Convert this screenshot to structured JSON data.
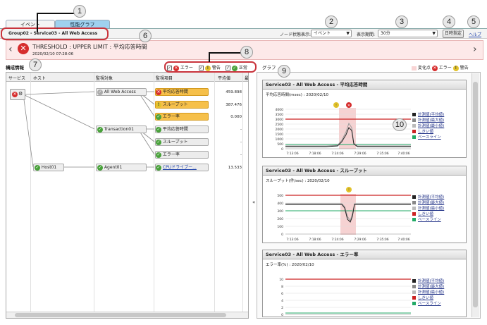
{
  "tabs": {
    "event": "イベント",
    "graph": "性能グラフ"
  },
  "breadcrumb": "Group02 - Service03 - All Web Access",
  "toolbar": {
    "node_status_label": "ノード状態表示:",
    "node_status_value": "イベント",
    "period_label": "表示期間:",
    "period_value": "30分",
    "time_button": "日時指定",
    "help_button": "ヘルプ"
  },
  "alert": {
    "title": "THRESHOLD : UPPER LIMIT : 平均応答時間",
    "time": "2020/02/10 07:28:06"
  },
  "config": {
    "title": "構成情報",
    "filters": {
      "error": "エラー",
      "warning": "警告",
      "normal": "正常"
    },
    "columns": [
      "サービス",
      "ホスト",
      "監視対象",
      "監視項目",
      "平均値",
      "最"
    ],
    "targets": [
      "All Web Access",
      "Transaction01",
      "Agent01"
    ],
    "host": "Host01",
    "items": [
      {
        "label": "平均応答時間",
        "value": "459.898"
      },
      {
        "label": "スループット",
        "value": "387.476"
      },
      {
        "label": "エラー率",
        "value": "0.000"
      },
      {
        "label": "平均応答時間",
        "value": "-"
      },
      {
        "label": "スループット",
        "value": "-"
      },
      {
        "label": "エラー率",
        "value": "-"
      },
      {
        "label": "CPUドライブー...",
        "value": "13.533"
      }
    ]
  },
  "graph": {
    "title": "グラフ",
    "legend_change": "変化点",
    "legend_error": "エラー",
    "legend_warning": "警告",
    "collapse": "«",
    "panels": [
      {
        "header": "Service03 - All Web Access - 平均応答時間",
        "sub": "平均応答時間(msec) : 2020/02/10",
        "yticks": [
          "4000",
          "3500",
          "3000",
          "2500",
          "2000",
          "1500",
          "1000",
          "500",
          "0"
        ],
        "xticks": [
          "7:13:06",
          "7:18:06",
          "7:24:06",
          "7:29:06",
          "7:35:06",
          "7:40:06"
        ]
      },
      {
        "header": "Service03 - All Web Access - スループット",
        "sub": "スループット(件/sec) : 2020/02/10",
        "yticks": [
          "500",
          "400",
          "300",
          "200",
          "100",
          "0"
        ],
        "xticks": [
          "7:13:06",
          "7:18:06",
          "7:24:06",
          "7:29:06",
          "7:35:06",
          "7:40:06"
        ]
      },
      {
        "header": "Service03 - All Web Access - エラー率",
        "sub": "エラー率(%) : 2020/02/10",
        "yticks": [
          "10",
          "8",
          "6",
          "4",
          "2",
          "0"
        ],
        "xticks": []
      }
    ],
    "legend_items": [
      "計測値(平均値)",
      "計測値(最大値)",
      "計測値(最小値)",
      "しきい値",
      "ベースライン"
    ]
  },
  "callouts": [
    "1",
    "2",
    "3",
    "4",
    "5",
    "6",
    "7",
    "8",
    "9",
    "10"
  ],
  "colors": {
    "accent_red": "#c9343c",
    "alert_bg": "#fde9e9",
    "threshold": "#cc2222",
    "baseline": "#22aa66"
  }
}
